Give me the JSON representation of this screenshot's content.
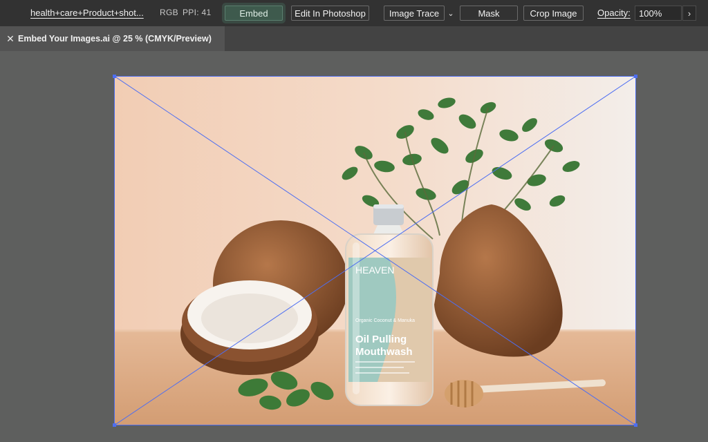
{
  "control_bar": {
    "filename": "health+care+Product+shot...",
    "color_mode": "RGB",
    "ppi": "PPI: 41",
    "embed_label": "Embed",
    "edit_photoshop_label": "Edit In Photoshop",
    "image_trace_label": "Image Trace",
    "mask_label": "Mask",
    "crop_label": "Crop Image",
    "opacity_label": "Opacity:",
    "opacity_value": "100%"
  },
  "document": {
    "tab_title": "Embed Your Images.ai @ 25 % (CMYK/Preview)"
  },
  "artwork": {
    "bottle_brand": "HEAVEN",
    "bottle_title_1": "Oil Pulling",
    "bottle_title_2": "Mouthwash",
    "bottle_variant": "Organic Coconut & Manuka"
  },
  "colors": {
    "selection": "#4d6ef2",
    "embed_accent": "#3e5a4d"
  }
}
